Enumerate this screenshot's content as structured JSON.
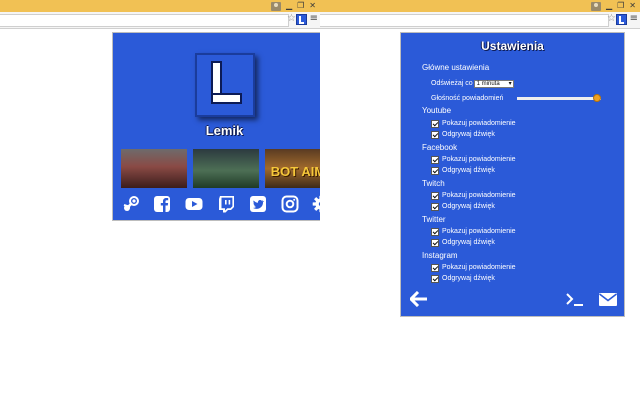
{
  "left_popup": {
    "name": "Lemik",
    "thumbnails": [
      {
        "caption": "",
        "overlay": ""
      },
      {
        "caption": "",
        "overlay": ""
      },
      {
        "caption": "",
        "overlay": "BOT AIM"
      }
    ],
    "socials": [
      "steam-icon",
      "facebook-icon",
      "youtube-icon",
      "twitch-icon",
      "twitter-icon",
      "instagram-icon",
      "settings-icon"
    ]
  },
  "settings": {
    "title": "Ustawienia",
    "main_label": "Główne ustawienia",
    "refresh_label": "Odświeżaj co",
    "refresh_value": "1 minuta",
    "volume_label": "Głośność powiadomień",
    "volume_level": 0.95,
    "sections": [
      {
        "name": "Youtube",
        "show": "Pokazuj powiadomienie",
        "sound": "Odgrywaj dźwięk"
      },
      {
        "name": "Facebook",
        "show": "Pokazuj powiadomienie",
        "sound": "Odgrywaj dźwięk"
      },
      {
        "name": "Twitch",
        "show": "Pokazuj powiadomienie",
        "sound": "Odgrywaj dźwięk"
      },
      {
        "name": "Twitter",
        "show": "Pokazuj powiadomienie",
        "sound": "Odgrywaj dźwięk"
      },
      {
        "name": "Instagram",
        "show": "Pokazuj powiadomienie",
        "sound": "Odgrywaj dźwięk"
      }
    ],
    "footer": {
      "back_icon": "arrow-left-icon",
      "console_icon": "terminal-icon",
      "mail_icon": "envelope-icon"
    }
  },
  "colors": {
    "brand": "#2b5ad8",
    "chrome_bar": "#f1c154",
    "slider_thumb": "#f0a020"
  }
}
